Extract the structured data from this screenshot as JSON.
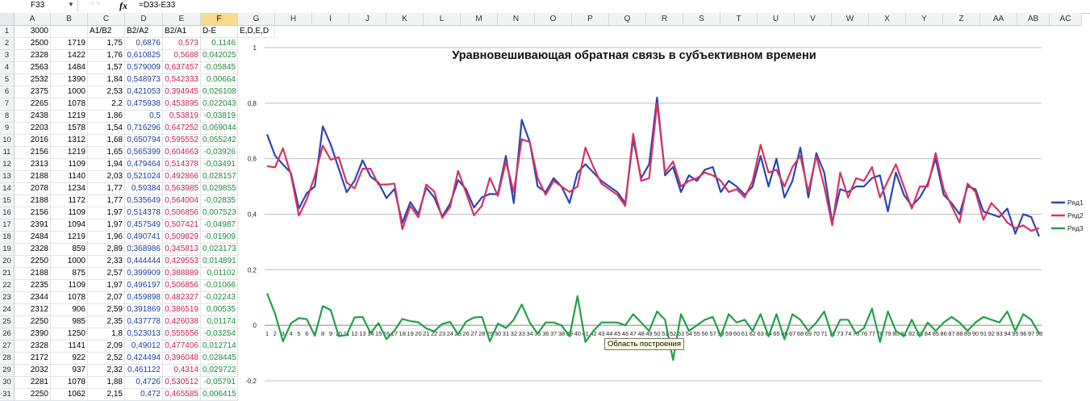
{
  "formula_bar": {
    "name_box": "F33",
    "fx": "fx",
    "formula": "=D33-E33"
  },
  "columns": [
    "A",
    "B",
    "C",
    "D",
    "E",
    "F",
    "G",
    "H",
    "I",
    "J",
    "K",
    "L",
    "M",
    "N",
    "O",
    "P",
    "Q",
    "R",
    "S",
    "T",
    "U",
    "V",
    "W",
    "X",
    "Y",
    "Z",
    "AA",
    "AB",
    "AC"
  ],
  "rows": [
    "1",
    "2",
    "3",
    "4",
    "5",
    "6",
    "7",
    "8",
    "9",
    "10",
    "11",
    "12",
    "13",
    "14",
    "15",
    "16",
    "17",
    "18",
    "19",
    "20",
    "21",
    "22",
    "23",
    "24",
    "25",
    "26",
    "27",
    "28",
    "29",
    "30",
    "31"
  ],
  "header_row": {
    "A": "3000",
    "B": "",
    "C": "A1/B2",
    "D": "B2/A2",
    "E": "B2/A1",
    "F": "D-E",
    "G": "E,D,E,D"
  },
  "table": [
    [
      "2500",
      "1719",
      "1,75",
      "0,6876",
      "0,573",
      "0,1146"
    ],
    [
      "2328",
      "1422",
      "1,76",
      "0,610825",
      "0,5688",
      "0,042025"
    ],
    [
      "2563",
      "1484",
      "1,57",
      "0,579009",
      "0,637457",
      "-0,05845"
    ],
    [
      "2532",
      "1390",
      "1,84",
      "0,548973",
      "0,542333",
      "0,00664"
    ],
    [
      "2375",
      "1000",
      "2,53",
      "0,421053",
      "0,394945",
      "0,026108"
    ],
    [
      "2265",
      "1078",
      "2,2",
      "0,475938",
      "0,453895",
      "0,022043"
    ],
    [
      "2438",
      "1219",
      "1,86",
      "0,5",
      "0,53819",
      "-0,03819"
    ],
    [
      "2203",
      "1578",
      "1,54",
      "0,716296",
      "0,647252",
      "0,069044"
    ],
    [
      "2016",
      "1312",
      "1,68",
      "0,650794",
      "0,595552",
      "0,055242"
    ],
    [
      "2156",
      "1219",
      "1,65",
      "0,565399",
      "0,604663",
      "-0,03926"
    ],
    [
      "2313",
      "1109",
      "1,94",
      "0,479464",
      "0,514378",
      "-0,03491"
    ],
    [
      "2188",
      "1140",
      "2,03",
      "0,521024",
      "0,492866",
      "0,028157"
    ],
    [
      "2078",
      "1234",
      "1,77",
      "0,59384",
      "0,563985",
      "0,029855"
    ],
    [
      "2188",
      "1172",
      "1,77",
      "0,535649",
      "0,564004",
      "-0,02835"
    ],
    [
      "2156",
      "1109",
      "1,97",
      "0,514378",
      "0,506856",
      "0,007523"
    ],
    [
      "2391",
      "1094",
      "1,97",
      "0,457549",
      "0,507421",
      "-0,04987"
    ],
    [
      "2484",
      "1219",
      "1,96",
      "0,490741",
      "0,509829",
      "-0,01909"
    ],
    [
      "2328",
      "859",
      "2,89",
      "0,368986",
      "0,345813",
      "0,023173"
    ],
    [
      "2250",
      "1000",
      "2,33",
      "0,444444",
      "0,429553",
      "0,014891"
    ],
    [
      "2188",
      "875",
      "2,57",
      "0,399909",
      "0,388889",
      "0,01102"
    ],
    [
      "2235",
      "1109",
      "1,97",
      "0,496197",
      "0,506856",
      "-0,01066"
    ],
    [
      "2344",
      "1078",
      "2,07",
      "0,459898",
      "0,482327",
      "-0,02243"
    ],
    [
      "2312",
      "906",
      "2,59",
      "0,391869",
      "0,386519",
      "0,00535"
    ],
    [
      "2250",
      "985",
      "2,35",
      "0,437778",
      "0,426038",
      "0,01174"
    ],
    [
      "2390",
      "1250",
      "1,8",
      "0,523013",
      "0,555556",
      "-0,03254"
    ],
    [
      "2328",
      "1141",
      "2,09",
      "0,49012",
      "0,477406",
      "0,012714"
    ],
    [
      "2172",
      "922",
      "2,52",
      "0,424494",
      "0,396048",
      "0,028445"
    ],
    [
      "2032",
      "937",
      "2,32",
      "0,461122",
      "0,4314",
      "0,029722"
    ],
    [
      "2281",
      "1078",
      "1,88",
      "0,4726",
      "0,530512",
      "-0,05791"
    ],
    [
      "2250",
      "1062",
      "2,15",
      "0,472",
      "0,465585",
      "0,006415"
    ]
  ],
  "colors": {
    "series1": "#2a45b8",
    "series2": "#d8325e",
    "series3": "#22a046",
    "selection": "#217346",
    "header_selected": "#f9d98e"
  },
  "chart_data": {
    "type": "line",
    "title": "Уравновешивающая обратная связь в субъективном времени",
    "ylim": [
      -0.2,
      1
    ],
    "yticks": [
      "1",
      "0,8",
      "0,6",
      "0,4",
      "0,2",
      "0",
      "-0,2"
    ],
    "grid": true,
    "legend_position": "right",
    "x": [
      1,
      2,
      3,
      4,
      5,
      6,
      7,
      8,
      9,
      10,
      11,
      12,
      13,
      14,
      15,
      16,
      17,
      18,
      19,
      20,
      21,
      22,
      23,
      24,
      25,
      26,
      27,
      28,
      29,
      30,
      31,
      32,
      33,
      34,
      35,
      36,
      37,
      38,
      39,
      40,
      41,
      42,
      43,
      44,
      45,
      46,
      47,
      48,
      49,
      50,
      51,
      52,
      53,
      54,
      55,
      56,
      57,
      58,
      59,
      60,
      61,
      62,
      63,
      64,
      65,
      66,
      67,
      68,
      69,
      70,
      71,
      72,
      73,
      74,
      75,
      76,
      77,
      78,
      79,
      80,
      81,
      82,
      83,
      84,
      85,
      86,
      87,
      88,
      89,
      90,
      91,
      92,
      93,
      94,
      95,
      96,
      97,
      98
    ],
    "series": [
      {
        "name": "Ряд1",
        "values": [
          0.688,
          0.611,
          0.579,
          0.549,
          0.421,
          0.476,
          0.5,
          0.716,
          0.651,
          0.565,
          0.479,
          0.521,
          0.594,
          0.536,
          0.514,
          0.458,
          0.491,
          0.369,
          0.444,
          0.4,
          0.496,
          0.46,
          0.392,
          0.438,
          0.523,
          0.49,
          0.424,
          0.461,
          0.473,
          0.472,
          0.61,
          0.44,
          0.74,
          0.66,
          0.5,
          0.48,
          0.53,
          0.5,
          0.44,
          0.55,
          0.58,
          0.55,
          0.52,
          0.5,
          0.48,
          0.44,
          0.67,
          0.53,
          0.58,
          0.82,
          0.54,
          0.57,
          0.48,
          0.54,
          0.52,
          0.56,
          0.57,
          0.48,
          0.52,
          0.5,
          0.47,
          0.5,
          0.61,
          0.5,
          0.6,
          0.46,
          0.52,
          0.64,
          0.46,
          0.62,
          0.55,
          0.37,
          0.49,
          0.48,
          0.5,
          0.5,
          0.53,
          0.54,
          0.41,
          0.55,
          0.47,
          0.43,
          0.46,
          0.51,
          0.6,
          0.47,
          0.44,
          0.4,
          0.5,
          0.49,
          0.41,
          0.4,
          0.39,
          0.42,
          0.33,
          0.4,
          0.39,
          0.32
        ],
        "_": ""
      },
      {
        "name": "Ряд2",
        "values": [
          0.573,
          0.569,
          0.637,
          0.542,
          0.395,
          0.454,
          0.538,
          0.647,
          0.596,
          0.605,
          0.514,
          0.493,
          0.564,
          0.564,
          0.507,
          0.507,
          0.51,
          0.346,
          0.43,
          0.389,
          0.507,
          0.482,
          0.387,
          0.426,
          0.556,
          0.477,
          0.396,
          0.431,
          0.531,
          0.466,
          0.59,
          0.48,
          0.67,
          0.66,
          0.53,
          0.47,
          0.52,
          0.5,
          0.48,
          0.5,
          0.64,
          0.57,
          0.51,
          0.49,
          0.47,
          0.43,
          0.69,
          0.52,
          0.53,
          0.8,
          0.55,
          0.59,
          0.5,
          0.52,
          0.53,
          0.55,
          0.54,
          0.52,
          0.48,
          0.49,
          0.46,
          0.52,
          0.65,
          0.55,
          0.56,
          0.5,
          0.57,
          0.61,
          0.48,
          0.61,
          0.5,
          0.36,
          0.55,
          0.46,
          0.53,
          0.52,
          0.57,
          0.46,
          0.52,
          0.58,
          0.5,
          0.42,
          0.5,
          0.5,
          0.62,
          0.49,
          0.43,
          0.37,
          0.51,
          0.48,
          0.38,
          0.44,
          0.41,
          0.37,
          0.35,
          0.36,
          0.34,
          0.35
        ],
        "_": ""
      },
      {
        "name": "Ряд3",
        "values": [
          0.115,
          0.042,
          -0.058,
          0.007,
          0.026,
          0.022,
          -0.038,
          0.069,
          0.055,
          -0.039,
          -0.035,
          0.028,
          0.03,
          -0.028,
          0.008,
          -0.05,
          -0.019,
          0.023,
          0.015,
          0.011,
          -0.011,
          -0.022,
          0.005,
          0.012,
          -0.033,
          0.013,
          0.028,
          0.03,
          -0.058,
          0.006,
          -0.01,
          0.02,
          0.075,
          0.01,
          -0.03,
          0.01,
          0.01,
          0.0,
          -0.04,
          0.105,
          -0.06,
          -0.02,
          0.01,
          0.01,
          0.01,
          0.0,
          0.04,
          0.01,
          -0.02,
          0.05,
          0.02,
          -0.125,
          0.04,
          -0.02,
          0.0,
          0.02,
          0.03,
          -0.04,
          0.04,
          0.01,
          0.02,
          -0.02,
          0.04,
          -0.04,
          0.04,
          -0.05,
          0.04,
          0.02,
          -0.02,
          0.01,
          0.05,
          -0.04,
          0.02,
          0.02,
          -0.03,
          -0.01,
          0.06,
          -0.06,
          0.05,
          -0.02,
          -0.04,
          0.02,
          -0.04,
          0.01,
          -0.02,
          0.01,
          0.03,
          0.01,
          -0.02,
          0.01,
          0.03,
          0.02,
          0.01,
          0.05,
          -0.02,
          0.04,
          0.02,
          -0.03
        ]
      }
    ],
    "legend": [
      "Ряд1",
      "Ряд2",
      "Ряд3"
    ],
    "tooltip": "Область построения"
  }
}
